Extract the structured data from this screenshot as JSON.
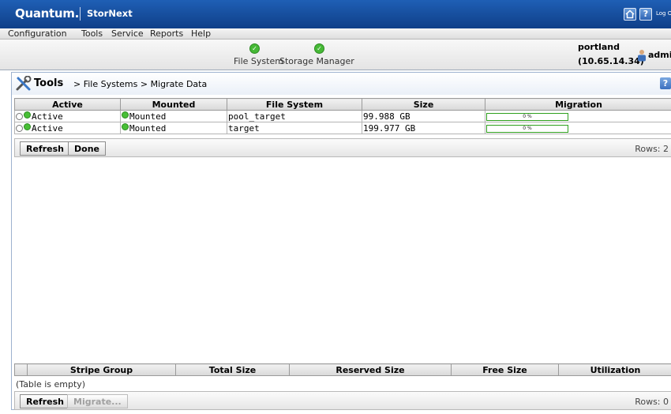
{
  "brand": {
    "logo": "Quantum.",
    "product": "StorNext",
    "logout": "Log Out"
  },
  "menu": [
    "Configuration",
    "Tools",
    "Service",
    "Reports",
    "Help"
  ],
  "status": {
    "items": [
      {
        "label": "File System",
        "state": "ok"
      },
      {
        "label": "Storage Manager",
        "state": "ok"
      }
    ],
    "host_name": "portland",
    "host_ip": "(10.65.14.34)",
    "user": "admin"
  },
  "breadcrumb": {
    "tools": "Tools",
    "rest": "> File Systems > Migrate Data"
  },
  "filesystems": {
    "columns": [
      "Active",
      "Mounted",
      "File System",
      "Size",
      "Migration"
    ],
    "rows": [
      {
        "active": "Active",
        "mounted": "Mounted",
        "file_system": "pool_target",
        "size": "99.988 GB",
        "migration": "0 %",
        "migration_fraction": 0
      },
      {
        "active": "Active",
        "mounted": "Mounted",
        "file_system": "target",
        "size": "199.977 GB",
        "migration": "0 %",
        "migration_fraction": 0
      }
    ],
    "buttons": {
      "refresh": "Refresh",
      "done": "Done"
    },
    "rows_label": "Rows: 2"
  },
  "stripe_groups": {
    "columns": [
      "Stripe Group",
      "Total Size",
      "Reserved Size",
      "Free Size",
      "Utilization"
    ],
    "empty_text": "(Table is empty)",
    "buttons": {
      "refresh": "Refresh",
      "migrate": "Migrate..."
    },
    "rows_label": "Rows: 0"
  },
  "colors": {
    "header_blue": "#1a56a8",
    "ok_green": "#48bf36"
  }
}
